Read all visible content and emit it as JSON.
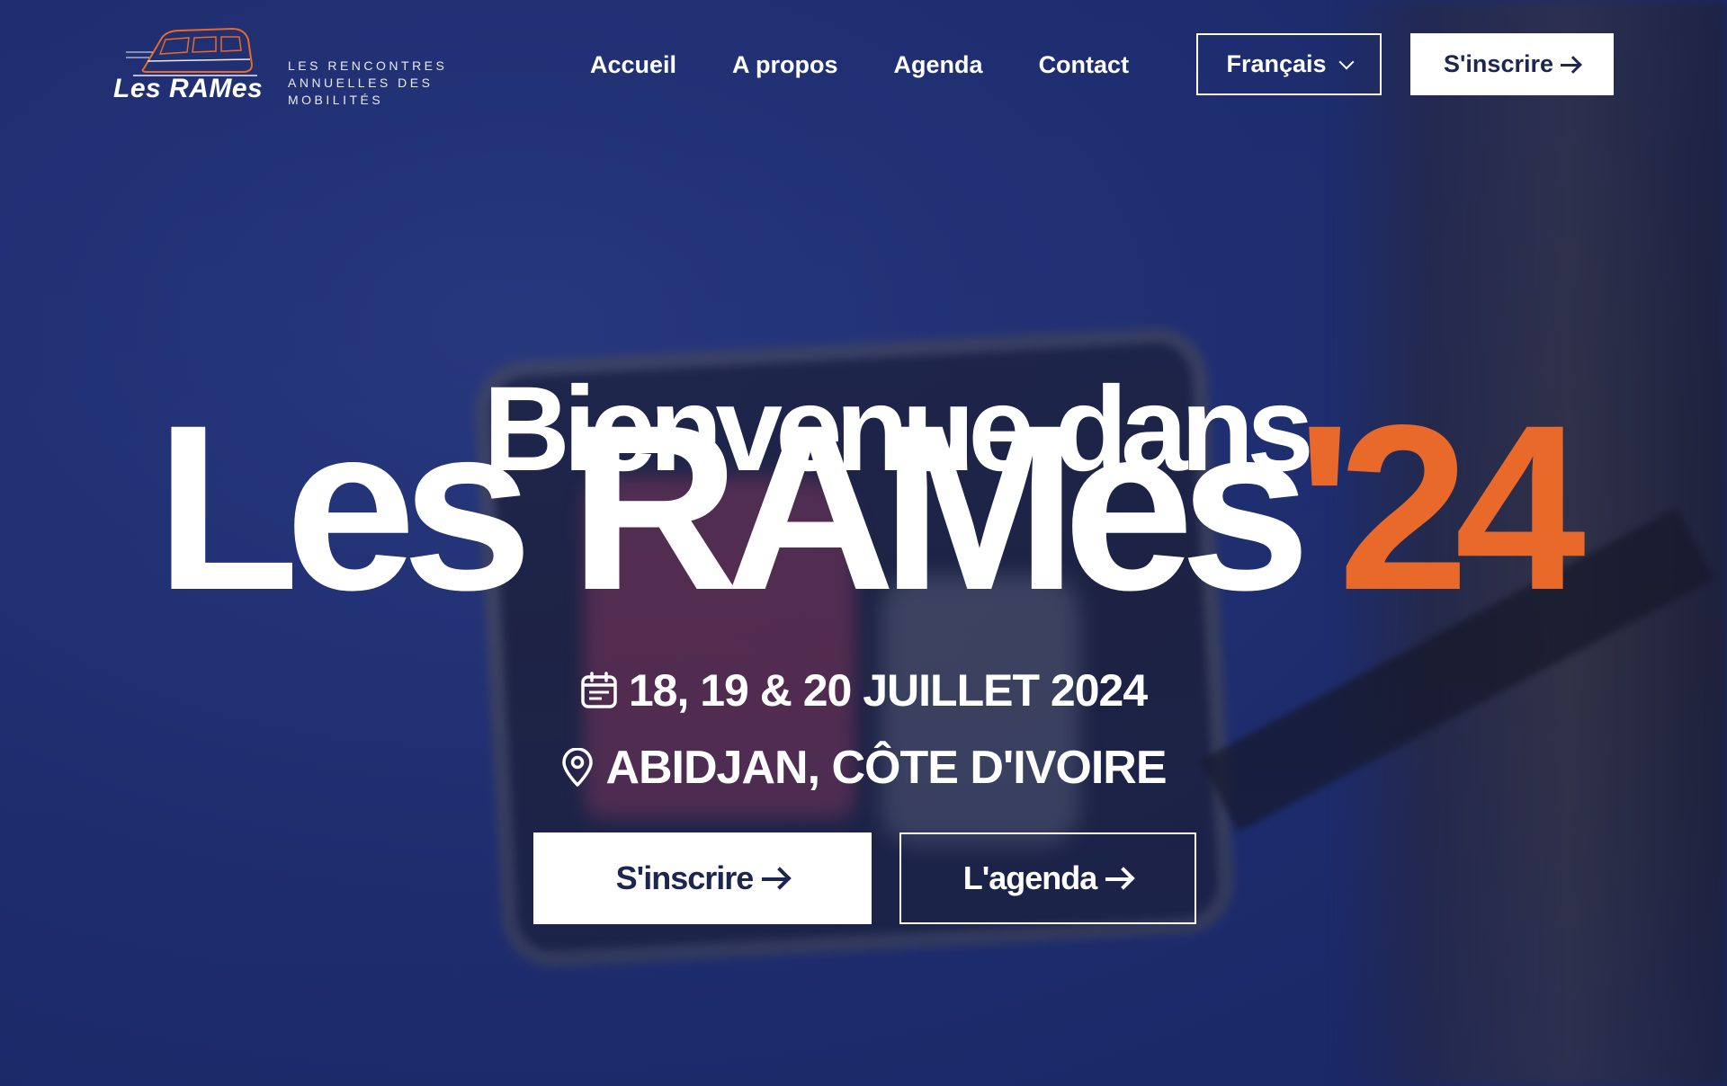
{
  "brand": {
    "name": "Les RAMes",
    "tagline_lines": [
      "LES RENCONTRES",
      "ANNUELLES DES",
      "MOBILITÉS"
    ],
    "accent_color": "#e8692a",
    "primary_color": "#1c2650"
  },
  "nav": {
    "items": [
      "Accueil",
      "A propos",
      "Agenda",
      "Contact"
    ],
    "language": "Français",
    "register_label": "S'inscrire"
  },
  "hero": {
    "title_line1": "Bienvenue dans",
    "title_line2_main": "Les RAMes",
    "title_line2_year": "'24",
    "date": "18, 19 & 20 JUILLET 2024",
    "location": "ABIDJAN, CÔTE D'IVOIRE",
    "date_icon": "calendar-icon",
    "location_icon": "map-pin-icon"
  },
  "cta": {
    "primary_label": "S'inscrire",
    "secondary_label": "L'agenda"
  }
}
